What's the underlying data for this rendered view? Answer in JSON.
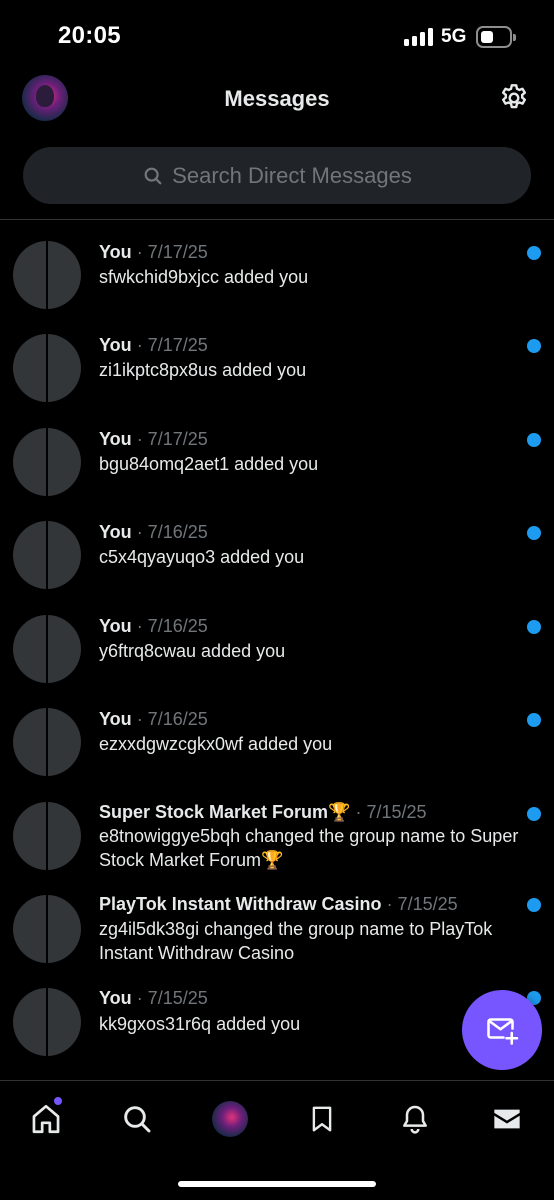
{
  "status_bar": {
    "time": "20:05",
    "network": "5G"
  },
  "header": {
    "title": "Messages",
    "avatar_icon": "profile-avatar",
    "settings_icon": "gear-icon"
  },
  "search": {
    "placeholder": "Search Direct Messages",
    "icon": "search-icon"
  },
  "conversations": [
    {
      "name": "You",
      "date": "· 7/17/25",
      "text": "sfwkchid9bxjcc added you",
      "unread": true
    },
    {
      "name": "You",
      "date": "· 7/17/25",
      "text": "zi1ikptc8px8us added you",
      "unread": true
    },
    {
      "name": "You",
      "date": "· 7/17/25",
      "text": "bgu84omq2aet1 added you",
      "unread": true
    },
    {
      "name": "You",
      "date": "· 7/16/25",
      "text": "c5x4qyayuqo3 added you",
      "unread": true
    },
    {
      "name": "You",
      "date": "· 7/16/25",
      "text": "y6ftrq8cwau added you",
      "unread": true
    },
    {
      "name": "You",
      "date": "· 7/16/25",
      "text": "ezxxdgwzcgkx0wf added you",
      "unread": true
    },
    {
      "name": "Super Stock Market Forum🏆",
      "date": "· 7/15/25",
      "text": "e8tnowiggye5bqh changed the group name to Super Stock Market Forum🏆",
      "unread": true
    },
    {
      "name": "PlayTok Instant Withdraw Casino",
      "date": "· 7/15/25",
      "text": "zg4il5dk38gi changed the group name to PlayTok Instant Withdraw Casino",
      "unread": true
    },
    {
      "name": "You",
      "date": "· 7/15/25",
      "text": "kk9gxos31r6q added you",
      "unread": true
    }
  ],
  "fab": {
    "icon": "new-message-icon"
  },
  "bottom_nav": {
    "items": [
      "home-icon",
      "search-icon",
      "profile-avatar",
      "bookmark-icon",
      "bell-icon",
      "mail-icon"
    ],
    "active": "home-icon"
  },
  "colors": {
    "background": "#000000",
    "accent_purple": "#7856ff",
    "unread_blue": "#1d9bf0",
    "secondary_text": "#71767b"
  }
}
